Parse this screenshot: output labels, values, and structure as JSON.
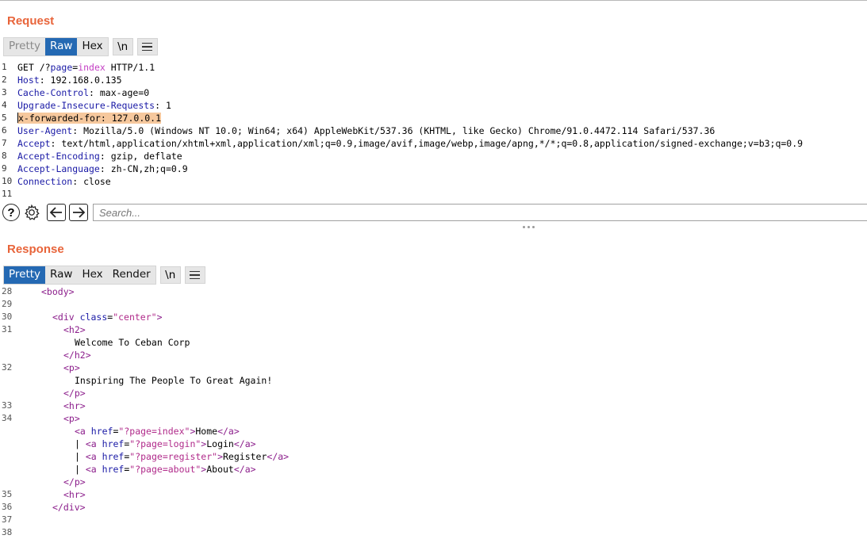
{
  "request": {
    "title": "Request",
    "tabs": [
      "Pretty",
      "Raw",
      "Hex"
    ],
    "newline_btn": "\\n",
    "lines": [
      {
        "n": "1",
        "parts": [
          [
            "GET /?",
            "t"
          ],
          [
            "page",
            "k"
          ],
          [
            "=",
            "t"
          ],
          [
            "index",
            "p"
          ],
          [
            " HTTP/1.1",
            "t"
          ]
        ]
      },
      {
        "n": "2",
        "parts": [
          [
            "Host",
            "k"
          ],
          [
            ": 192.168.0.135",
            "t"
          ]
        ]
      },
      {
        "n": "3",
        "parts": [
          [
            "Cache-Control",
            "k"
          ],
          [
            ": max-age=0",
            "t"
          ]
        ]
      },
      {
        "n": "4",
        "parts": [
          [
            "Upgrade-Insecure-Requests",
            "k"
          ],
          [
            ": 1",
            "t"
          ]
        ]
      },
      {
        "n": "5",
        "parts": [
          [
            "x-forwarded-for",
            "hlk"
          ],
          [
            ": 127.0.0.1",
            "hl"
          ]
        ]
      },
      {
        "n": "6",
        "parts": [
          [
            "User-Agent",
            "k"
          ],
          [
            ": Mozilla/5.0 (Windows NT 10.0; Win64; x64) AppleWebKit/537.36 (KHTML, like Gecko) Chrome/91.0.4472.114 Safari/537.36",
            "t"
          ]
        ]
      },
      {
        "n": "7",
        "parts": [
          [
            "Accept",
            "k"
          ],
          [
            ": text/html,application/xhtml+xml,application/xml;q=0.9,image/avif,image/webp,image/apng,*/*;q=0.8,application/signed-exchange;v=b3;q=0.9",
            "t"
          ]
        ]
      },
      {
        "n": "8",
        "parts": [
          [
            "Accept-Encoding",
            "k"
          ],
          [
            ": gzip, deflate",
            "t"
          ]
        ]
      },
      {
        "n": "9",
        "parts": [
          [
            "Accept-Language",
            "k"
          ],
          [
            ": zh-CN,zh;q=0.9",
            "t"
          ]
        ]
      },
      {
        "n": "10",
        "parts": [
          [
            "Connection",
            "k"
          ],
          [
            ": close",
            "t"
          ]
        ]
      },
      {
        "n": "11",
        "parts": []
      }
    ]
  },
  "toolbar": {
    "search_placeholder": "Search..."
  },
  "response": {
    "title": "Response",
    "tabs": [
      "Pretty",
      "Raw",
      "Hex",
      "Render"
    ],
    "newline_btn": "\\n",
    "lines": [
      {
        "n": "28",
        "indent": 4,
        "parts": [
          [
            "<body>",
            "tag"
          ]
        ]
      },
      {
        "n": "29",
        "indent": 0,
        "parts": []
      },
      {
        "n": "30",
        "indent": 6,
        "parts": [
          [
            "<div ",
            "tag"
          ],
          [
            "class",
            "attr"
          ],
          [
            "=",
            "t"
          ],
          [
            "\"center\"",
            "str"
          ],
          [
            ">",
            "tag"
          ]
        ]
      },
      {
        "n": "31",
        "indent": 8,
        "parts": [
          [
            "<h2>",
            "tag"
          ]
        ]
      },
      {
        "n": "",
        "indent": 10,
        "parts": [
          [
            "Welcome To Ceban Corp",
            "t"
          ]
        ]
      },
      {
        "n": "",
        "indent": 8,
        "parts": [
          [
            "</h2>",
            "tag"
          ]
        ]
      },
      {
        "n": "32",
        "indent": 8,
        "parts": [
          [
            "<p>",
            "tag"
          ]
        ]
      },
      {
        "n": "",
        "indent": 10,
        "parts": [
          [
            "Inspiring The People To Great Again!",
            "t"
          ]
        ]
      },
      {
        "n": "",
        "indent": 8,
        "parts": [
          [
            "</p>",
            "tag"
          ]
        ]
      },
      {
        "n": "33",
        "indent": 8,
        "parts": [
          [
            "<hr>",
            "tag"
          ]
        ]
      },
      {
        "n": "34",
        "indent": 8,
        "parts": [
          [
            "<p>",
            "tag"
          ]
        ]
      },
      {
        "n": "",
        "indent": 10,
        "parts": [
          [
            "<a ",
            "tag"
          ],
          [
            "href",
            "attr"
          ],
          [
            "=",
            "t"
          ],
          [
            "\"?page=index\"",
            "str"
          ],
          [
            ">",
            "tag"
          ],
          [
            "Home",
            "t"
          ],
          [
            "</a>",
            "tag"
          ]
        ]
      },
      {
        "n": "",
        "indent": 10,
        "parts": [
          [
            "| ",
            "t"
          ],
          [
            "<a ",
            "tag"
          ],
          [
            "href",
            "attr"
          ],
          [
            "=",
            "t"
          ],
          [
            "\"?page=login\"",
            "str"
          ],
          [
            ">",
            "tag"
          ],
          [
            "Login",
            "t"
          ],
          [
            "</a>",
            "tag"
          ]
        ]
      },
      {
        "n": "",
        "indent": 10,
        "parts": [
          [
            "| ",
            "t"
          ],
          [
            "<a ",
            "tag"
          ],
          [
            "href",
            "attr"
          ],
          [
            "=",
            "t"
          ],
          [
            "\"?page=register\"",
            "str"
          ],
          [
            ">",
            "tag"
          ],
          [
            "Register",
            "t"
          ],
          [
            "</a>",
            "tag"
          ]
        ]
      },
      {
        "n": "",
        "indent": 10,
        "parts": [
          [
            "| ",
            "t"
          ],
          [
            "<a ",
            "tag"
          ],
          [
            "href",
            "attr"
          ],
          [
            "=",
            "t"
          ],
          [
            "\"?page=about\"",
            "str"
          ],
          [
            ">",
            "tag"
          ],
          [
            "About",
            "t"
          ],
          [
            "</a>",
            "tag"
          ]
        ]
      },
      {
        "n": "",
        "indent": 8,
        "parts": [
          [
            "</p>",
            "tag"
          ]
        ]
      },
      {
        "n": "35",
        "indent": 8,
        "parts": [
          [
            "<hr>",
            "tag"
          ]
        ]
      },
      {
        "n": "36",
        "indent": 6,
        "parts": [
          [
            "</div>",
            "tag"
          ]
        ]
      },
      {
        "n": "37",
        "indent": 0,
        "parts": []
      },
      {
        "n": "38",
        "indent": 0,
        "parts": []
      }
    ]
  },
  "colors": {
    "accent": "#e8643a",
    "active_tab": "#2469b3",
    "highlight": "#f6c89d"
  }
}
